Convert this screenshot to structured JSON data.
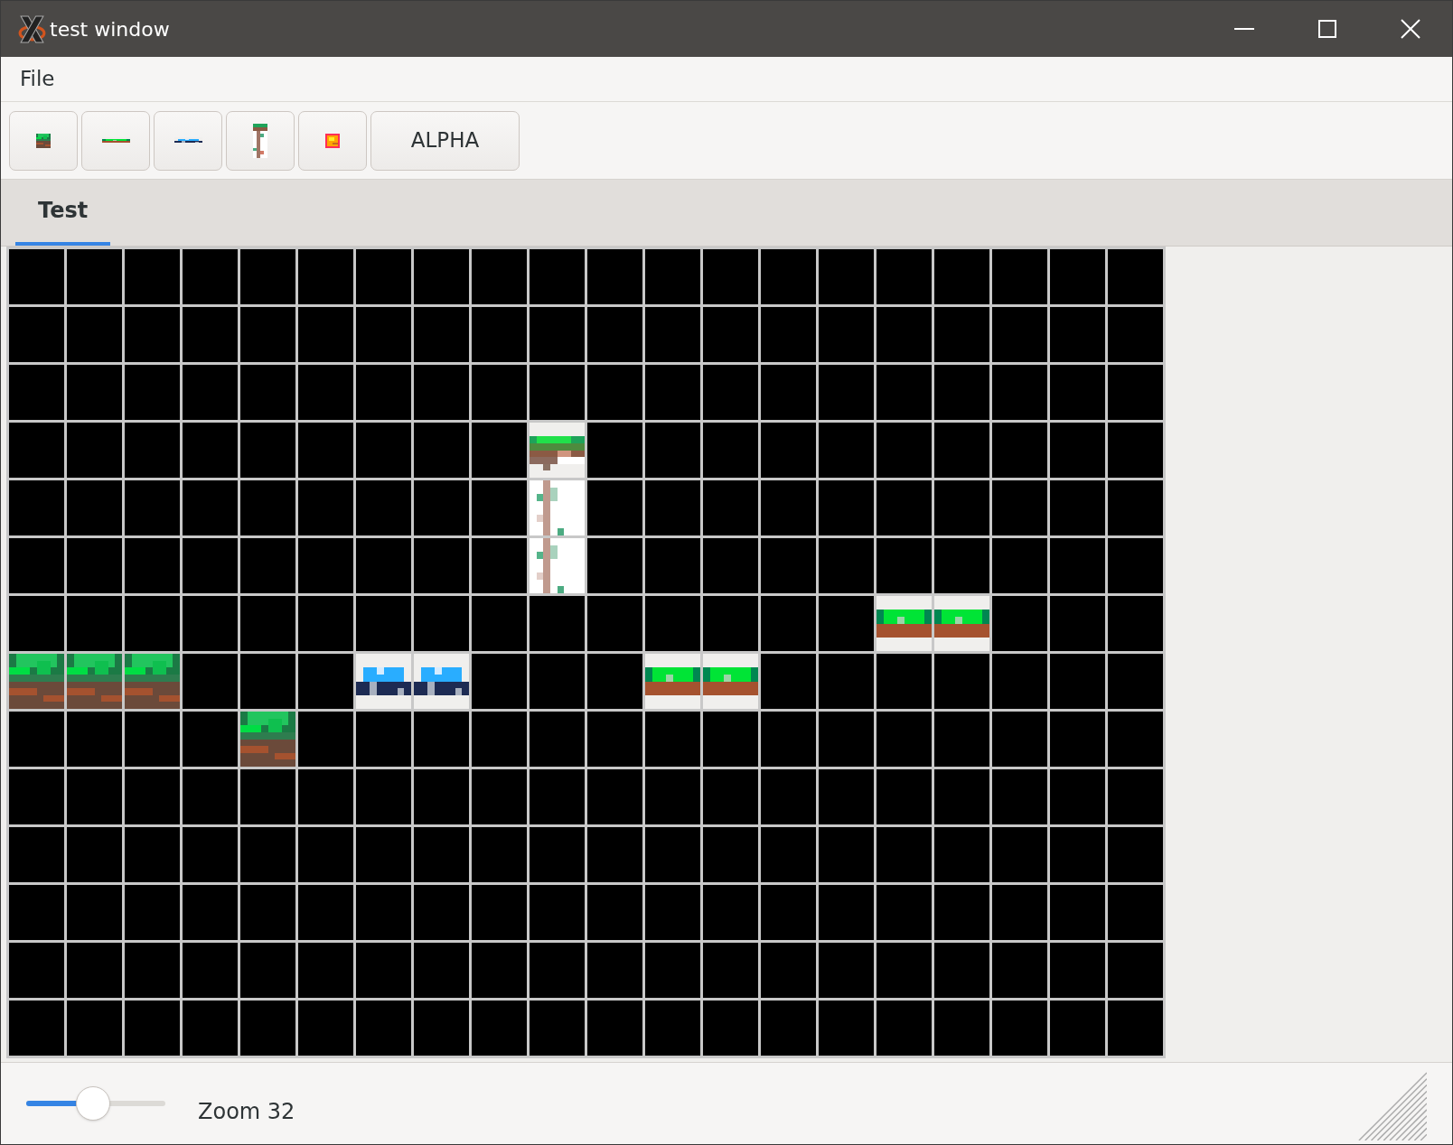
{
  "window": {
    "title": "test window"
  },
  "menu": [
    {
      "label": "File"
    }
  ],
  "toolbar": [
    {
      "kind": "grass-block"
    },
    {
      "kind": "grass-flat"
    },
    {
      "kind": "water"
    },
    {
      "kind": "tree"
    },
    {
      "kind": "lava"
    },
    {
      "kind": "text",
      "label": "ALPHA"
    }
  ],
  "tabs": [
    {
      "label": "Test",
      "selected": true
    }
  ],
  "grid": {
    "rows": [
      [
        {
          "kind": "empty"
        },
        {
          "kind": "empty"
        },
        {
          "kind": "empty"
        },
        {
          "kind": "empty"
        },
        {
          "kind": "empty"
        },
        {
          "kind": "empty"
        },
        {
          "kind": "empty"
        },
        {
          "kind": "empty"
        },
        {
          "kind": "empty"
        },
        {
          "kind": "empty"
        },
        {
          "kind": "empty"
        },
        {
          "kind": "empty"
        },
        {
          "kind": "empty"
        },
        {
          "kind": "empty"
        },
        {
          "kind": "empty"
        },
        {
          "kind": "empty"
        },
        {
          "kind": "empty"
        },
        {
          "kind": "empty"
        },
        {
          "kind": "empty"
        },
        {
          "kind": "empty"
        }
      ],
      [
        {
          "kind": "empty"
        },
        {
          "kind": "empty"
        },
        {
          "kind": "empty"
        },
        {
          "kind": "empty"
        },
        {
          "kind": "empty"
        },
        {
          "kind": "empty"
        },
        {
          "kind": "empty"
        },
        {
          "kind": "empty"
        },
        {
          "kind": "empty"
        },
        {
          "kind": "empty"
        },
        {
          "kind": "empty"
        },
        {
          "kind": "empty"
        },
        {
          "kind": "empty"
        },
        {
          "kind": "empty"
        },
        {
          "kind": "empty"
        },
        {
          "kind": "empty"
        },
        {
          "kind": "empty"
        },
        {
          "kind": "empty"
        },
        {
          "kind": "empty"
        },
        {
          "kind": "empty"
        }
      ],
      [
        {
          "kind": "empty"
        },
        {
          "kind": "empty"
        },
        {
          "kind": "empty"
        },
        {
          "kind": "empty"
        },
        {
          "kind": "empty"
        },
        {
          "kind": "empty"
        },
        {
          "kind": "empty"
        },
        {
          "kind": "empty"
        },
        {
          "kind": "empty"
        },
        {
          "kind": "empty"
        },
        {
          "kind": "empty"
        },
        {
          "kind": "empty"
        },
        {
          "kind": "empty"
        },
        {
          "kind": "empty"
        },
        {
          "kind": "empty"
        },
        {
          "kind": "empty"
        },
        {
          "kind": "empty"
        },
        {
          "kind": "empty"
        },
        {
          "kind": "empty"
        },
        {
          "kind": "empty"
        }
      ],
      [
        {
          "kind": "empty"
        },
        {
          "kind": "empty"
        },
        {
          "kind": "empty"
        },
        {
          "kind": "empty"
        },
        {
          "kind": "empty"
        },
        {
          "kind": "empty"
        },
        {
          "kind": "empty"
        },
        {
          "kind": "empty"
        },
        {
          "kind": "empty"
        },
        {
          "kind": "tree-top"
        },
        {
          "kind": "empty"
        },
        {
          "kind": "empty"
        },
        {
          "kind": "empty"
        },
        {
          "kind": "empty"
        },
        {
          "kind": "empty"
        },
        {
          "kind": "empty"
        },
        {
          "kind": "empty"
        },
        {
          "kind": "empty"
        },
        {
          "kind": "empty"
        },
        {
          "kind": "empty"
        }
      ],
      [
        {
          "kind": "empty"
        },
        {
          "kind": "empty"
        },
        {
          "kind": "empty"
        },
        {
          "kind": "empty"
        },
        {
          "kind": "empty"
        },
        {
          "kind": "empty"
        },
        {
          "kind": "empty"
        },
        {
          "kind": "empty"
        },
        {
          "kind": "empty"
        },
        {
          "kind": "tree-trunk"
        },
        {
          "kind": "empty"
        },
        {
          "kind": "empty"
        },
        {
          "kind": "empty"
        },
        {
          "kind": "empty"
        },
        {
          "kind": "empty"
        },
        {
          "kind": "empty"
        },
        {
          "kind": "empty"
        },
        {
          "kind": "empty"
        },
        {
          "kind": "empty"
        },
        {
          "kind": "empty"
        }
      ],
      [
        {
          "kind": "empty"
        },
        {
          "kind": "empty"
        },
        {
          "kind": "empty"
        },
        {
          "kind": "empty"
        },
        {
          "kind": "empty"
        },
        {
          "kind": "empty"
        },
        {
          "kind": "empty"
        },
        {
          "kind": "empty"
        },
        {
          "kind": "empty"
        },
        {
          "kind": "tree-trunk"
        },
        {
          "kind": "empty"
        },
        {
          "kind": "empty"
        },
        {
          "kind": "empty"
        },
        {
          "kind": "empty"
        },
        {
          "kind": "empty"
        },
        {
          "kind": "empty"
        },
        {
          "kind": "empty"
        },
        {
          "kind": "empty"
        },
        {
          "kind": "empty"
        },
        {
          "kind": "empty"
        }
      ],
      [
        {
          "kind": "empty"
        },
        {
          "kind": "empty"
        },
        {
          "kind": "empty"
        },
        {
          "kind": "empty"
        },
        {
          "kind": "empty"
        },
        {
          "kind": "empty"
        },
        {
          "kind": "empty"
        },
        {
          "kind": "empty"
        },
        {
          "kind": "empty"
        },
        {
          "kind": "empty"
        },
        {
          "kind": "empty"
        },
        {
          "kind": "empty"
        },
        {
          "kind": "empty"
        },
        {
          "kind": "empty"
        },
        {
          "kind": "empty"
        },
        {
          "kind": "grass-flat"
        },
        {
          "kind": "grass-flat"
        },
        {
          "kind": "empty"
        },
        {
          "kind": "empty"
        },
        {
          "kind": "empty"
        }
      ],
      [
        {
          "kind": "grass-block"
        },
        {
          "kind": "grass-block"
        },
        {
          "kind": "grass-block"
        },
        {
          "kind": "empty"
        },
        {
          "kind": "empty"
        },
        {
          "kind": "empty"
        },
        {
          "kind": "water"
        },
        {
          "kind": "water"
        },
        {
          "kind": "empty"
        },
        {
          "kind": "empty"
        },
        {
          "kind": "empty"
        },
        {
          "kind": "grass-flat"
        },
        {
          "kind": "grass-flat"
        },
        {
          "kind": "empty"
        },
        {
          "kind": "empty"
        },
        {
          "kind": "empty"
        },
        {
          "kind": "empty"
        },
        {
          "kind": "empty"
        },
        {
          "kind": "empty"
        },
        {
          "kind": "empty"
        }
      ],
      [
        {
          "kind": "empty"
        },
        {
          "kind": "empty"
        },
        {
          "kind": "empty"
        },
        {
          "kind": "empty"
        },
        {
          "kind": "grass-block"
        },
        {
          "kind": "empty"
        },
        {
          "kind": "empty"
        },
        {
          "kind": "empty"
        },
        {
          "kind": "empty"
        },
        {
          "kind": "empty"
        },
        {
          "kind": "empty"
        },
        {
          "kind": "empty"
        },
        {
          "kind": "empty"
        },
        {
          "kind": "empty"
        },
        {
          "kind": "empty"
        },
        {
          "kind": "empty"
        },
        {
          "kind": "empty"
        },
        {
          "kind": "empty"
        },
        {
          "kind": "empty"
        },
        {
          "kind": "empty"
        }
      ],
      [
        {
          "kind": "empty"
        },
        {
          "kind": "empty"
        },
        {
          "kind": "empty"
        },
        {
          "kind": "empty"
        },
        {
          "kind": "empty"
        },
        {
          "kind": "empty"
        },
        {
          "kind": "empty"
        },
        {
          "kind": "empty"
        },
        {
          "kind": "empty"
        },
        {
          "kind": "empty"
        },
        {
          "kind": "empty"
        },
        {
          "kind": "empty"
        },
        {
          "kind": "empty"
        },
        {
          "kind": "empty"
        },
        {
          "kind": "empty"
        },
        {
          "kind": "empty"
        },
        {
          "kind": "empty"
        },
        {
          "kind": "empty"
        },
        {
          "kind": "empty"
        },
        {
          "kind": "empty"
        }
      ],
      [
        {
          "kind": "empty"
        },
        {
          "kind": "empty"
        },
        {
          "kind": "empty"
        },
        {
          "kind": "empty"
        },
        {
          "kind": "empty"
        },
        {
          "kind": "empty"
        },
        {
          "kind": "empty"
        },
        {
          "kind": "empty"
        },
        {
          "kind": "empty"
        },
        {
          "kind": "empty"
        },
        {
          "kind": "empty"
        },
        {
          "kind": "empty"
        },
        {
          "kind": "empty"
        },
        {
          "kind": "empty"
        },
        {
          "kind": "empty"
        },
        {
          "kind": "empty"
        },
        {
          "kind": "empty"
        },
        {
          "kind": "empty"
        },
        {
          "kind": "empty"
        },
        {
          "kind": "empty"
        }
      ],
      [
        {
          "kind": "empty"
        },
        {
          "kind": "empty"
        },
        {
          "kind": "empty"
        },
        {
          "kind": "empty"
        },
        {
          "kind": "empty"
        },
        {
          "kind": "empty"
        },
        {
          "kind": "empty"
        },
        {
          "kind": "empty"
        },
        {
          "kind": "empty"
        },
        {
          "kind": "empty"
        },
        {
          "kind": "empty"
        },
        {
          "kind": "empty"
        },
        {
          "kind": "empty"
        },
        {
          "kind": "empty"
        },
        {
          "kind": "empty"
        },
        {
          "kind": "empty"
        },
        {
          "kind": "empty"
        },
        {
          "kind": "empty"
        },
        {
          "kind": "empty"
        },
        {
          "kind": "empty"
        }
      ],
      [
        {
          "kind": "empty"
        },
        {
          "kind": "empty"
        },
        {
          "kind": "empty"
        },
        {
          "kind": "empty"
        },
        {
          "kind": "empty"
        },
        {
          "kind": "empty"
        },
        {
          "kind": "empty"
        },
        {
          "kind": "empty"
        },
        {
          "kind": "empty"
        },
        {
          "kind": "empty"
        },
        {
          "kind": "empty"
        },
        {
          "kind": "empty"
        },
        {
          "kind": "empty"
        },
        {
          "kind": "empty"
        },
        {
          "kind": "empty"
        },
        {
          "kind": "empty"
        },
        {
          "kind": "empty"
        },
        {
          "kind": "empty"
        },
        {
          "kind": "empty"
        },
        {
          "kind": "empty"
        }
      ],
      [
        {
          "kind": "empty"
        },
        {
          "kind": "empty"
        },
        {
          "kind": "empty"
        },
        {
          "kind": "empty"
        },
        {
          "kind": "empty"
        },
        {
          "kind": "empty"
        },
        {
          "kind": "empty"
        },
        {
          "kind": "empty"
        },
        {
          "kind": "empty"
        },
        {
          "kind": "empty"
        },
        {
          "kind": "empty"
        },
        {
          "kind": "empty"
        },
        {
          "kind": "empty"
        },
        {
          "kind": "empty"
        },
        {
          "kind": "empty"
        },
        {
          "kind": "empty"
        },
        {
          "kind": "empty"
        },
        {
          "kind": "empty"
        },
        {
          "kind": "empty"
        },
        {
          "kind": "empty"
        }
      ]
    ]
  },
  "zoom": {
    "level": 0.48,
    "label": "Zoom 32"
  }
}
